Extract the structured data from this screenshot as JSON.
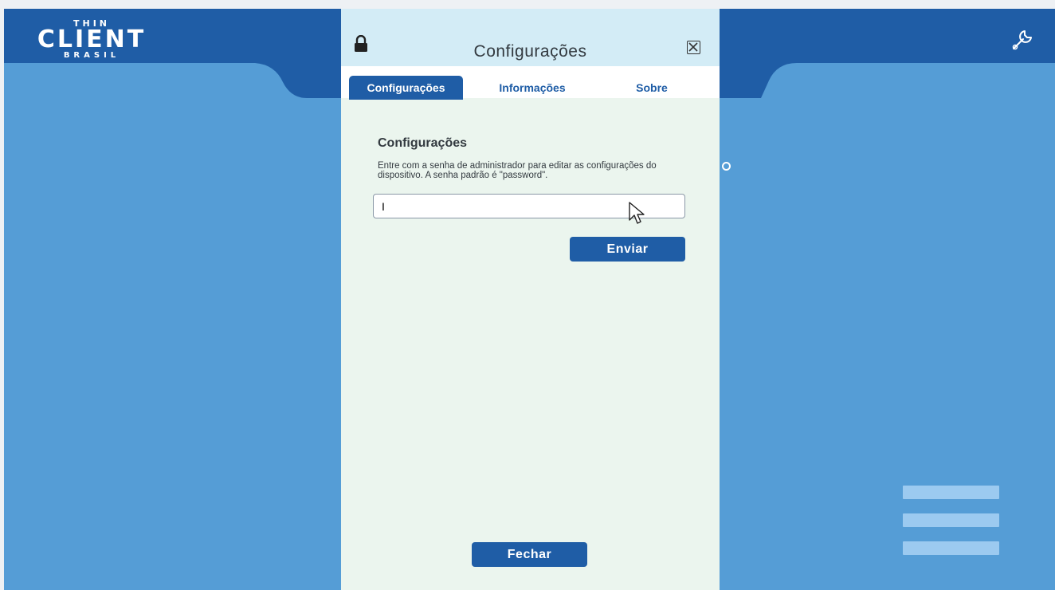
{
  "app": {
    "logo": {
      "line1": "THIN",
      "line2": "CLIENT",
      "line3": "BRASIL"
    },
    "icons": {
      "settings": "wrench-icon"
    },
    "colors": {
      "background": "#559dd6",
      "header": "#1f5da6",
      "dialog": "#ebf5ee",
      "accent": "#1f5da6"
    }
  },
  "dialog": {
    "title": "Configurações",
    "tabs": [
      {
        "label": "Configurações",
        "active": true
      },
      {
        "label": "Informações",
        "active": false
      },
      {
        "label": "Sobre",
        "active": false
      }
    ],
    "section_title": "Configurações",
    "description": "Entre com a senha de administrador para editar as configurações do dispositivo. A senha padrão é \"password\".",
    "password_value": "I",
    "submit_label": "Enviar",
    "close_label": "Fechar"
  }
}
